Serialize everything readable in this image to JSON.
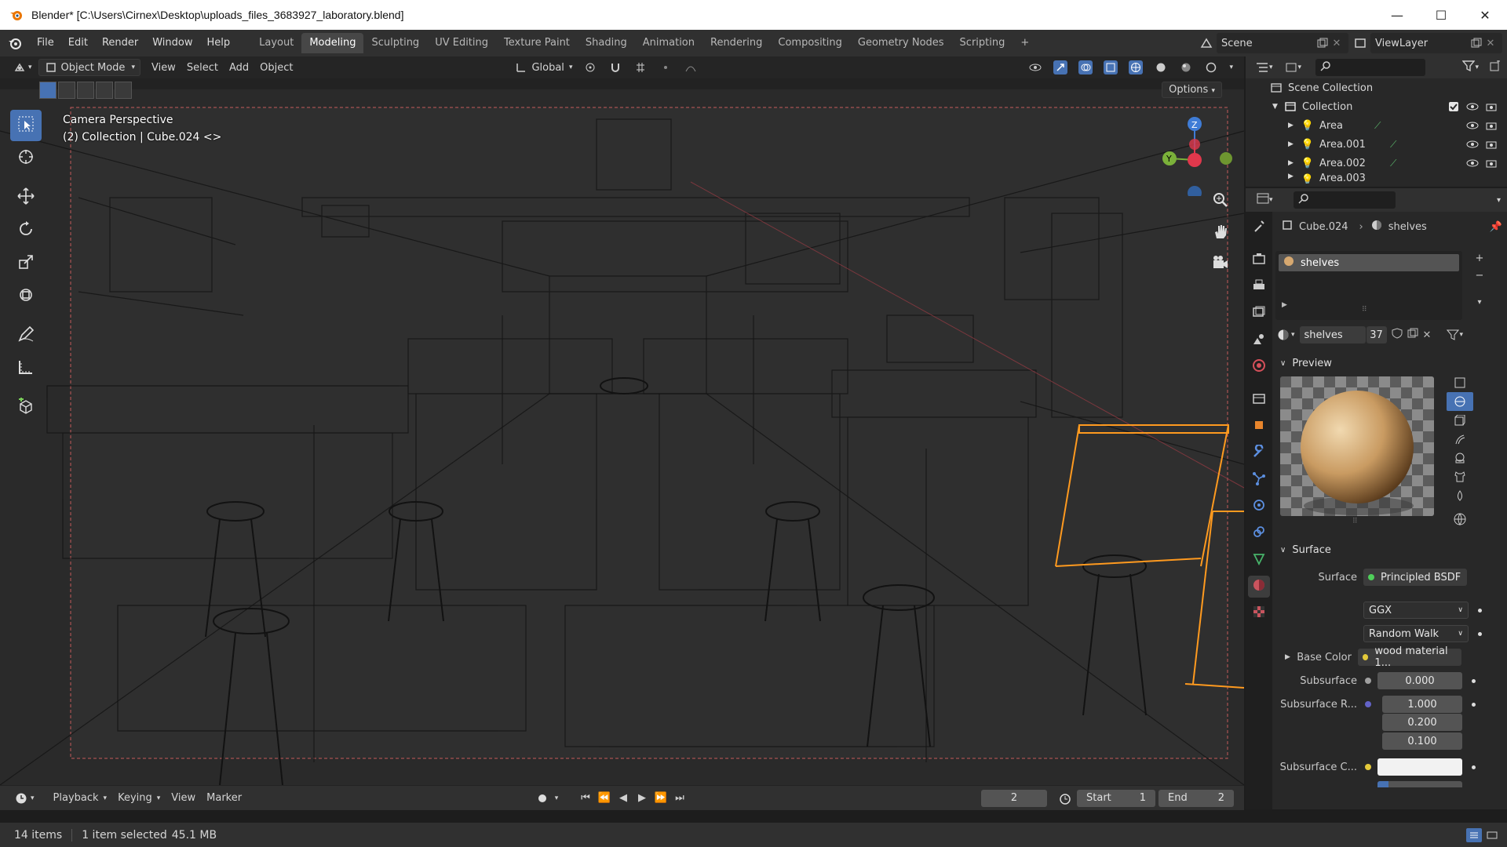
{
  "window": {
    "title": "Blender* [C:\\Users\\Cirnex\\Desktop\\uploads_files_3683927_laboratory.blend]",
    "minimize": "—",
    "maximize": "☐",
    "close": "✕"
  },
  "menubar": {
    "items": [
      "File",
      "Edit",
      "Render",
      "Window",
      "Help"
    ],
    "workspaces": [
      "Layout",
      "Modeling",
      "Sculpting",
      "UV Editing",
      "Texture Paint",
      "Shading",
      "Animation",
      "Rendering",
      "Compositing",
      "Geometry Nodes",
      "Scripting"
    ],
    "active_workspace": "Modeling",
    "add_workspace": "+",
    "scene": "Scene",
    "view_layer": "ViewLayer"
  },
  "viewport": {
    "mode": "Object Mode",
    "menus": [
      "View",
      "Select",
      "Add",
      "Object"
    ],
    "orientation": "Global",
    "options": "Options",
    "camera_label": "Camera Perspective",
    "collection_label": "(2) Collection | Cube.024 <>",
    "gizmo": {
      "z": "Z",
      "y": "Y"
    }
  },
  "timeline": {
    "menus": [
      "Playback",
      "Keying",
      "View",
      "Marker"
    ],
    "current_frame": "2",
    "start_label": "Start",
    "start": "1",
    "end_label": "End",
    "end": "2"
  },
  "statusbar": {
    "items": "14 items",
    "selection": "1 item selected",
    "memory": "45.1 MB"
  },
  "outliner": {
    "scene_collection": "Scene Collection",
    "collection": "Collection",
    "items": [
      "Area",
      "Area.001",
      "Area.002",
      "Area.003"
    ]
  },
  "properties": {
    "object": "Cube.024",
    "material": "shelves",
    "slot": "shelves",
    "material_users": "37",
    "preview_label": "Preview",
    "surface_panel": "Surface",
    "surface_label": "Surface",
    "surface_value": "Principled BSDF",
    "distribution": "GGX",
    "subsurface_method": "Random Walk",
    "base_color_label": "Base Color",
    "base_color_value": "wood material 1...",
    "subsurface_label": "Subsurface",
    "subsurface_value": "0.000",
    "subsurface_radius_label": "Subsurface R...",
    "subsurface_radius": [
      "1.000",
      "0.200",
      "0.100"
    ],
    "subsurface_color_label": "Subsurface C..."
  },
  "colors": {
    "accent": "#4772b3",
    "selection": "#ff9a1f",
    "x_axis": "#e0384c",
    "y_axis": "#7bb13a",
    "z_axis": "#3f7cd6"
  }
}
